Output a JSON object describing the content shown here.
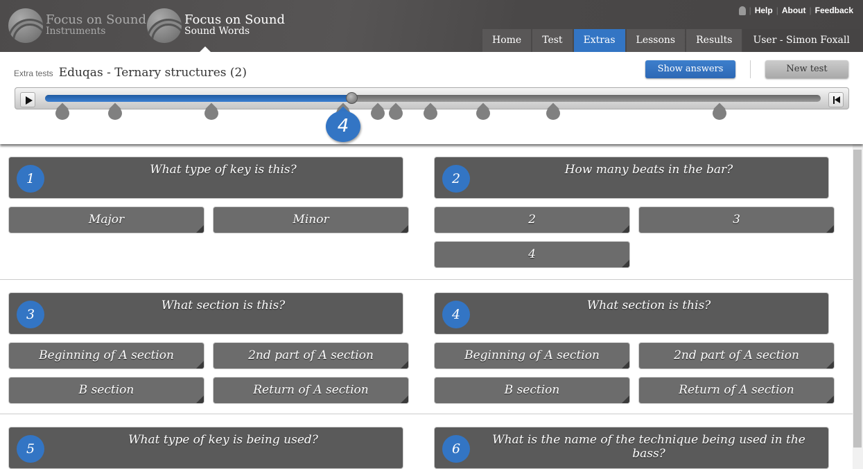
{
  "header": {
    "logos": [
      {
        "line1": "Focus on Sound",
        "line2": "Instruments"
      },
      {
        "line1": "Focus on Sound",
        "line2": "Sound Words"
      }
    ],
    "toplinks": [
      "Help",
      "About",
      "Feedback"
    ],
    "nav": [
      "Home",
      "Test",
      "Extras",
      "Lessons",
      "Results",
      "User - Simon Foxall"
    ],
    "active_tab": "Extras"
  },
  "page": {
    "section": "Extra tests",
    "title": "Eduqas - Ternary structures (2)",
    "show_answers": "Show answers",
    "new_test": "New test"
  },
  "player": {
    "progress_percent": 39.5,
    "current_marker": "4"
  },
  "colors": {
    "accent": "#3375c4",
    "header": "#4a4848",
    "question": "#5a5a5a",
    "answer": "#6c6c6c"
  },
  "questions": [
    {
      "num": "1",
      "text": "What type of key is this?",
      "answers": [
        "Major",
        "Minor"
      ]
    },
    {
      "num": "2",
      "text": "How many beats in the bar?",
      "answers": [
        "2",
        "3",
        "4"
      ]
    },
    {
      "num": "3",
      "text": "What section is this?",
      "answers": [
        "Beginning of A section",
        "2nd part of A section",
        "B section",
        "Return of A section"
      ]
    },
    {
      "num": "4",
      "text": "What section is this?",
      "answers": [
        "Beginning of A section",
        "2nd part of A section",
        "B section",
        "Return of A section"
      ]
    },
    {
      "num": "5",
      "text": "What type of key is being used?",
      "answers": []
    },
    {
      "num": "6",
      "text": "What is the name of the technique being used in the bass?",
      "answers": []
    }
  ]
}
